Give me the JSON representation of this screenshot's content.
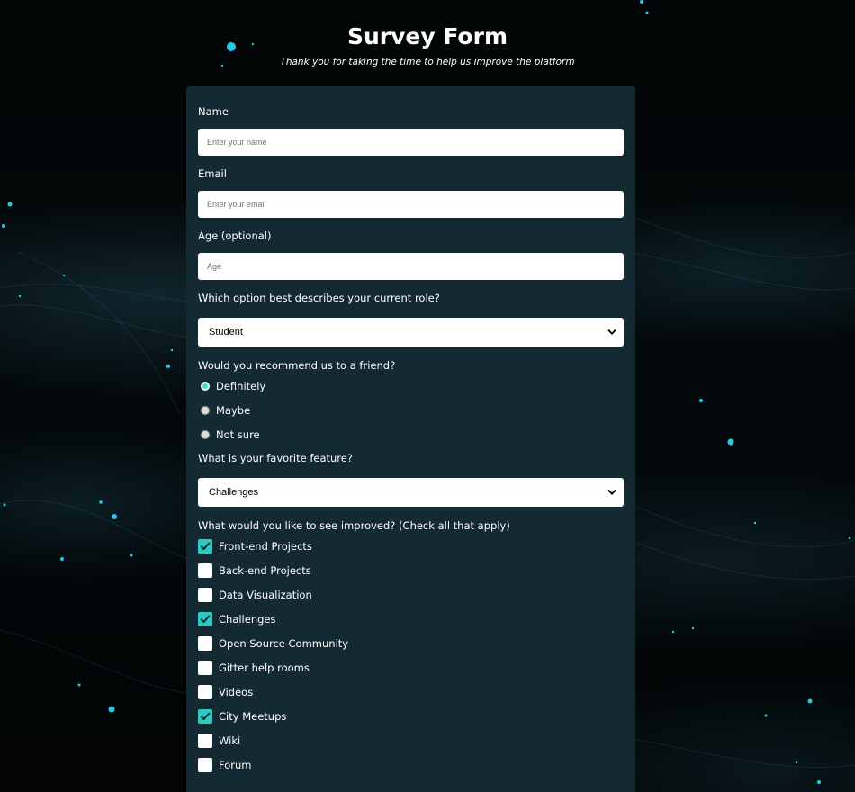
{
  "header": {
    "title": "Survey Form",
    "subtitle": "Thank you for taking the time to help us improve the platform"
  },
  "form": {
    "name": {
      "label": "Name",
      "placeholder": "Enter your name",
      "value": ""
    },
    "email": {
      "label": "Email",
      "placeholder": "Enter your email",
      "value": ""
    },
    "age": {
      "label": "Age (optional)",
      "placeholder": "Age",
      "value": ""
    },
    "role": {
      "label": "Which option best describes your current role?",
      "selected": "Student"
    },
    "recommend": {
      "label": "Would you recommend us to a friend?",
      "options": [
        {
          "label": "Definitely",
          "checked": true
        },
        {
          "label": "Maybe",
          "checked": false
        },
        {
          "label": "Not sure",
          "checked": false
        }
      ]
    },
    "feature": {
      "label": "What is your favorite feature?",
      "selected": "Challenges"
    },
    "improve": {
      "label": "What would you like to see improved? (Check all that apply)",
      "options": [
        {
          "label": "Front-end Projects",
          "checked": true
        },
        {
          "label": "Back-end Projects",
          "checked": false
        },
        {
          "label": "Data Visualization",
          "checked": false
        },
        {
          "label": "Challenges",
          "checked": true
        },
        {
          "label": "Open Source Community",
          "checked": false
        },
        {
          "label": "Gitter help rooms",
          "checked": false
        },
        {
          "label": "Videos",
          "checked": false
        },
        {
          "label": "City Meetups",
          "checked": true
        },
        {
          "label": "Wiki",
          "checked": false
        },
        {
          "label": "Forum",
          "checked": false
        }
      ]
    }
  },
  "colors": {
    "background": "#000000",
    "form_panel": "#142a33",
    "accent": "#2fc9c2",
    "text": "#ffffff"
  }
}
